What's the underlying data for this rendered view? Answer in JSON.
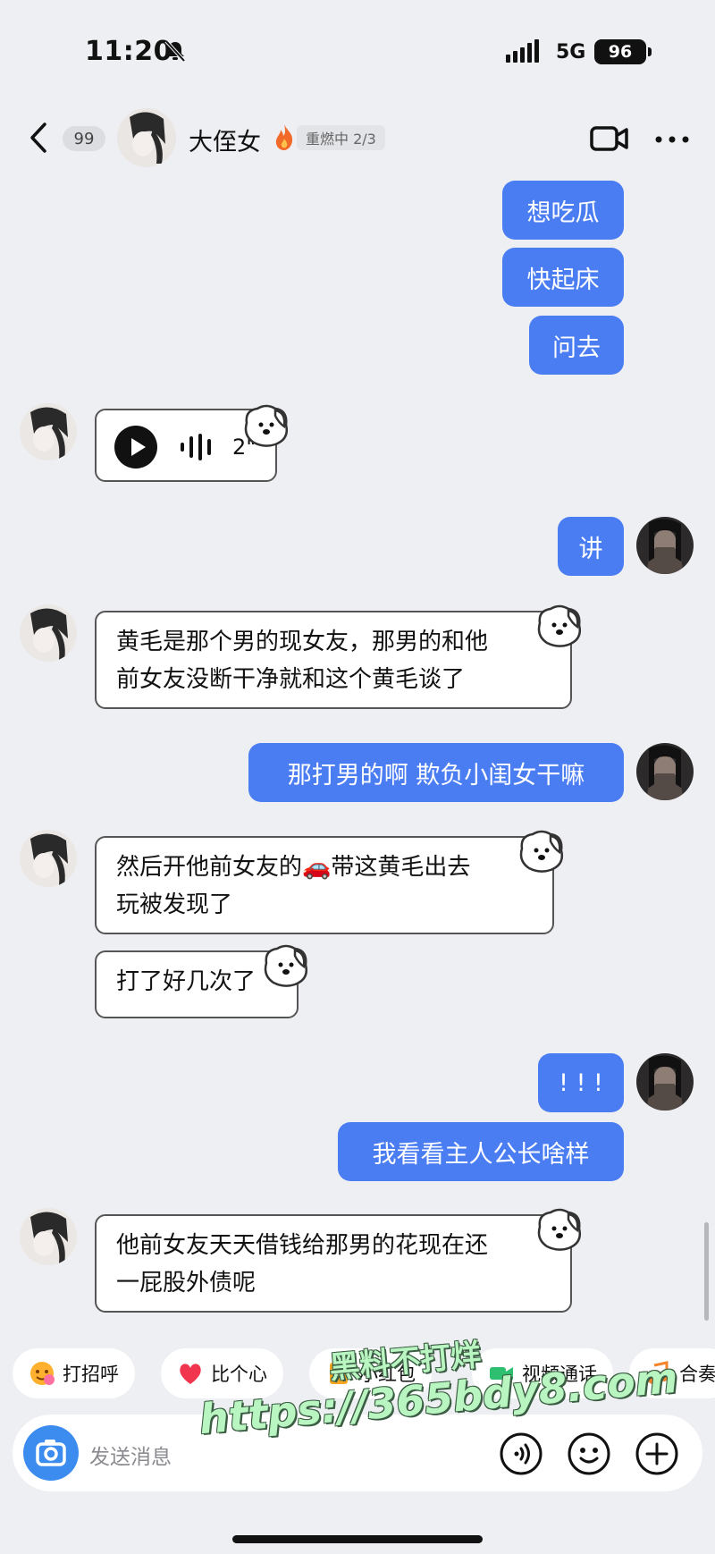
{
  "status_bar": {
    "time": "11:20",
    "network": "5G",
    "battery": "96"
  },
  "header": {
    "back_count": "99",
    "contact_name": "大侄女",
    "streak_label": "重燃中 2/3"
  },
  "messages": [
    {
      "side": "out",
      "text": "想吃瓜"
    },
    {
      "side": "out",
      "text": "快起床"
    },
    {
      "side": "out",
      "text": "问去"
    },
    {
      "side": "in",
      "type": "voice",
      "duration": "2\""
    },
    {
      "side": "out",
      "text": "讲"
    },
    {
      "side": "in",
      "lines": [
        "黄毛是那个男的现女友，那男的和他",
        "前女友没断干净就和这个黄毛谈了"
      ]
    },
    {
      "side": "out",
      "text": "那打男的啊 欺负小闺女干嘛"
    },
    {
      "side": "in",
      "lines": [
        "然后开他前女友的🚗带这黄毛出去",
        "玩被发现了"
      ]
    },
    {
      "side": "in",
      "lines": [
        "打了好几次了"
      ]
    },
    {
      "side": "out",
      "text": "! ! !"
    },
    {
      "side": "out",
      "text": "我看看主人公长啥样"
    },
    {
      "side": "in",
      "lines": [
        "他前女友天天借钱给那男的花现在还",
        "一屁股外债呢"
      ]
    }
  ],
  "quick_actions": [
    "打招呼",
    "比个心",
    "小红包",
    "视频通话",
    "合奏"
  ],
  "input": {
    "placeholder": "发送消息"
  },
  "watermark": {
    "line1": "黑料不打烊",
    "line2": "https://365bdy8.com"
  },
  "colors": {
    "bubble_out": "#4b7df2",
    "background": "#eeeff2",
    "accent_camera": "#3c8cf0"
  }
}
